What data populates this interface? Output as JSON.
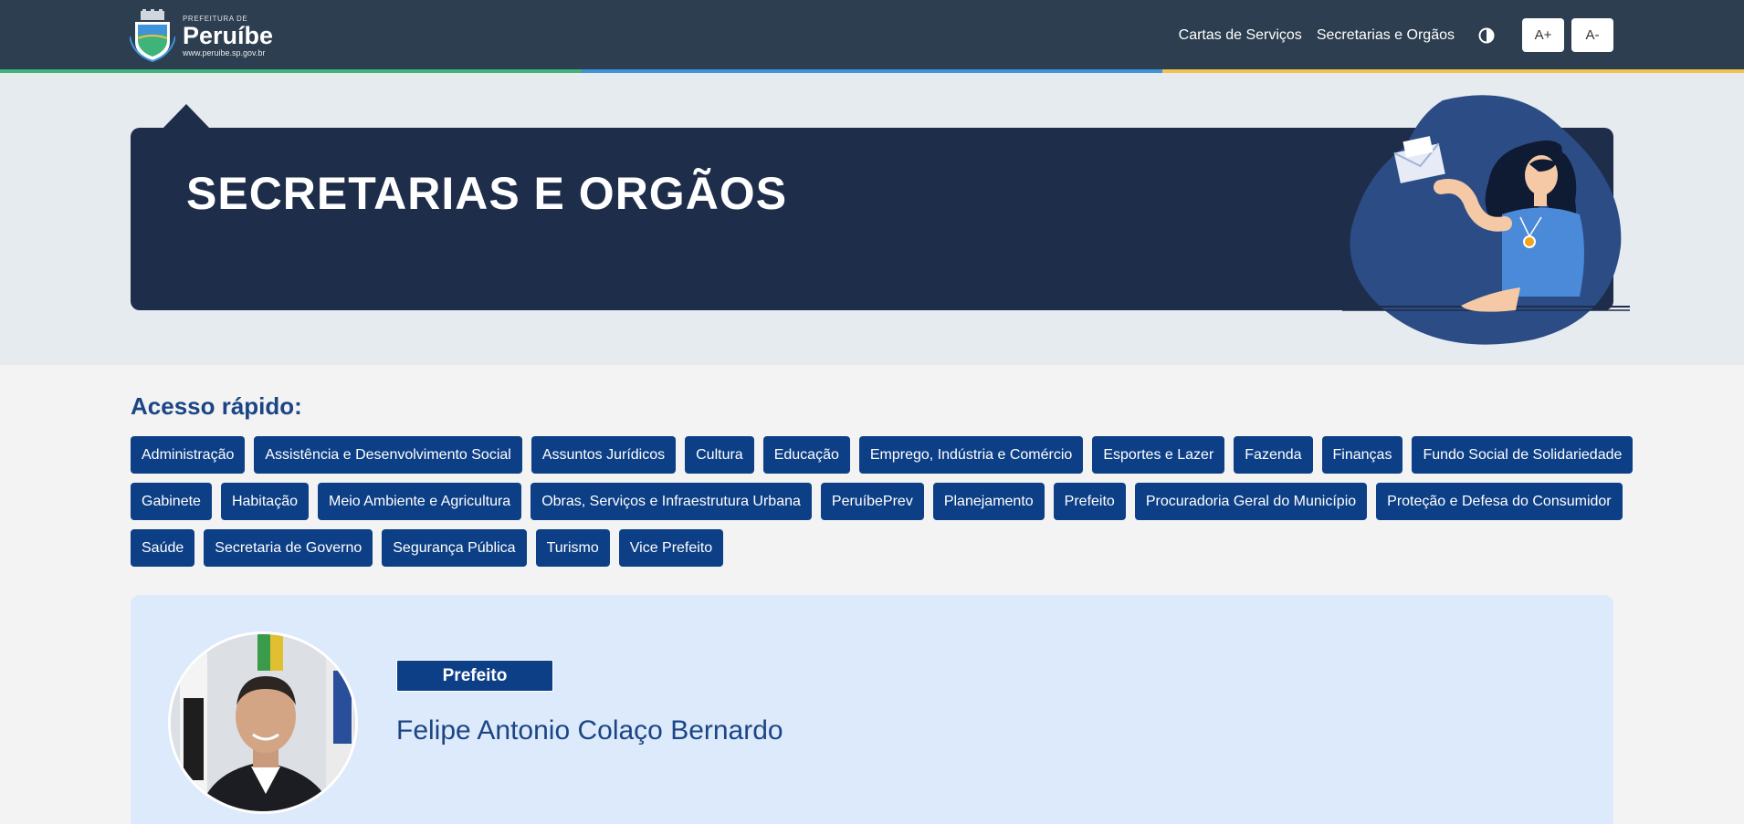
{
  "header": {
    "logo": {
      "small_text": "PREFEITURA DE",
      "name": "Peruíbe",
      "url": "www.peruibe.sp.gov.br"
    },
    "nav": {
      "cartas_label": "Cartas de Serviços",
      "secretarias_label": "Secretarias e Orgãos",
      "contrast_icon": "contrast-icon",
      "font_increase_label": "A+",
      "font_decrease_label": "A-"
    },
    "stripe_colors": [
      "#3fb37a",
      "#3f93d9",
      "#f2c14e"
    ]
  },
  "hero": {
    "title": "SECRETARIAS E ORGÃOS"
  },
  "quick_access": {
    "title": "Acesso rápido:",
    "rows": [
      [
        "Administração",
        "Assistência e Desenvolvimento Social",
        "Assuntos Jurídicos",
        "Cultura",
        "Educação",
        "Emprego, Indústria e Comércio",
        "Esportes e Lazer",
        "Fazenda",
        "Finanças",
        "Fundo Social de Solidariedade"
      ],
      [
        "Gabinete",
        "Habitação",
        "Meio Ambiente e Agricultura",
        "Obras, Serviços e Infraestrutura Urbana",
        "PeruíbePrev",
        "Planejamento",
        "Prefeito",
        "Procuradoria Geral do Município",
        "Proteção e Defesa do Consumidor"
      ],
      [
        "Saúde",
        "Secretaria de Governo",
        "Segurança Pública",
        "Turismo",
        "Vice Prefeito"
      ]
    ]
  },
  "profile": {
    "role": "Prefeito",
    "name": "Felipe Antonio Colaço Bernardo"
  },
  "colors": {
    "header_bg": "#2d3e50",
    "banner_bg": "#1e2d4a",
    "tag_bg": "#0d3f86",
    "accent_text": "#1b4585",
    "card_bg": "#ddeafb"
  }
}
